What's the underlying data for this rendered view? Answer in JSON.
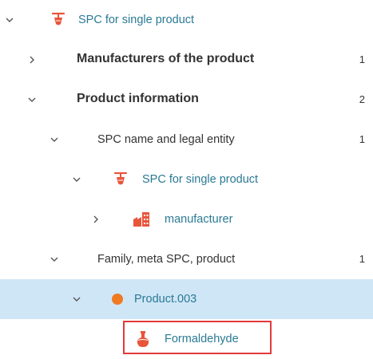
{
  "tree": {
    "nodes": [
      {
        "label": "SPC for single product",
        "count": "",
        "expanded": true,
        "icon": "spc-product-icon"
      },
      {
        "label": "Manufacturers of the product",
        "count": "1",
        "expanded": false,
        "icon": ""
      },
      {
        "label": "Product information",
        "count": "2",
        "expanded": true,
        "icon": ""
      },
      {
        "label": "SPC name and legal entity",
        "count": "1",
        "expanded": true,
        "icon": ""
      },
      {
        "label": "SPC for single product",
        "count": "",
        "expanded": true,
        "icon": "spc-product-icon"
      },
      {
        "label": "manufacturer",
        "count": "",
        "expanded": false,
        "icon": "factory-icon"
      },
      {
        "label": "Family, meta SPC, product",
        "count": "1",
        "expanded": true,
        "icon": ""
      },
      {
        "label": "Product.003",
        "count": "",
        "expanded": true,
        "selected": true,
        "icon": "orange-dot-icon"
      },
      {
        "label": "Formaldehyde",
        "count": "",
        "highlighted": true,
        "icon": "flask-icon"
      }
    ]
  },
  "colors": {
    "selected_row": "#cfe6f7",
    "highlight_border": "#e23a3a",
    "node_teal": "#2a7a94",
    "icon_orange_red": "#e8553b",
    "dot_orange": "#f07a22"
  }
}
